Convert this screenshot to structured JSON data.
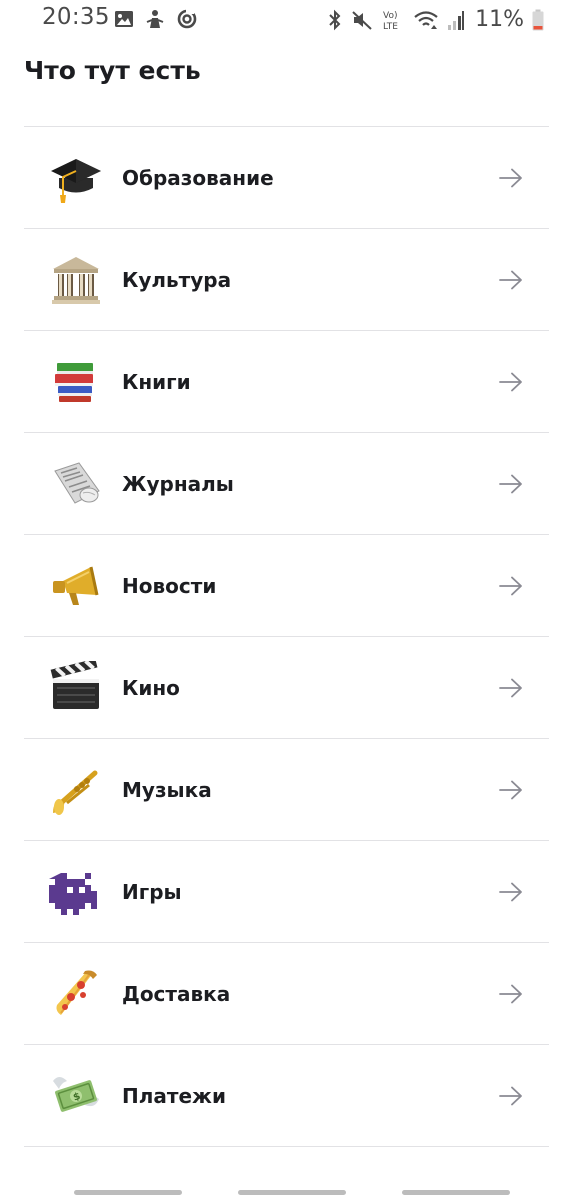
{
  "status_bar": {
    "time": "20:35",
    "battery_percent": "11%",
    "network_label": "Vo) LTE",
    "left_icons": [
      "image-icon",
      "app-notification-icon",
      "sync-icon"
    ],
    "right_icons": [
      "bluetooth-icon",
      "mute-icon",
      "volte-icon",
      "wifi-icon",
      "signal-icon",
      "battery-icon"
    ]
  },
  "page": {
    "title": "Что тут есть"
  },
  "categories": [
    {
      "label": "Образование",
      "icon": "graduation-cap-icon"
    },
    {
      "label": "Культура",
      "icon": "classical-building-icon"
    },
    {
      "label": "Книги",
      "icon": "books-icon"
    },
    {
      "label": "Журналы",
      "icon": "newspaper-roll-icon"
    },
    {
      "label": "Новости",
      "icon": "megaphone-icon"
    },
    {
      "label": "Кино",
      "icon": "clapper-board-icon"
    },
    {
      "label": "Музыка",
      "icon": "trumpet-icon"
    },
    {
      "label": "Игры",
      "icon": "space-invader-icon"
    },
    {
      "label": "Доставка",
      "icon": "pizza-icon"
    },
    {
      "label": "Платежи",
      "icon": "money-with-wings-icon"
    }
  ],
  "colors": {
    "text": "#1c1d21",
    "divider": "#e2e2e5",
    "arrow": "#8a8a93",
    "battery_low": "#e8543c"
  }
}
